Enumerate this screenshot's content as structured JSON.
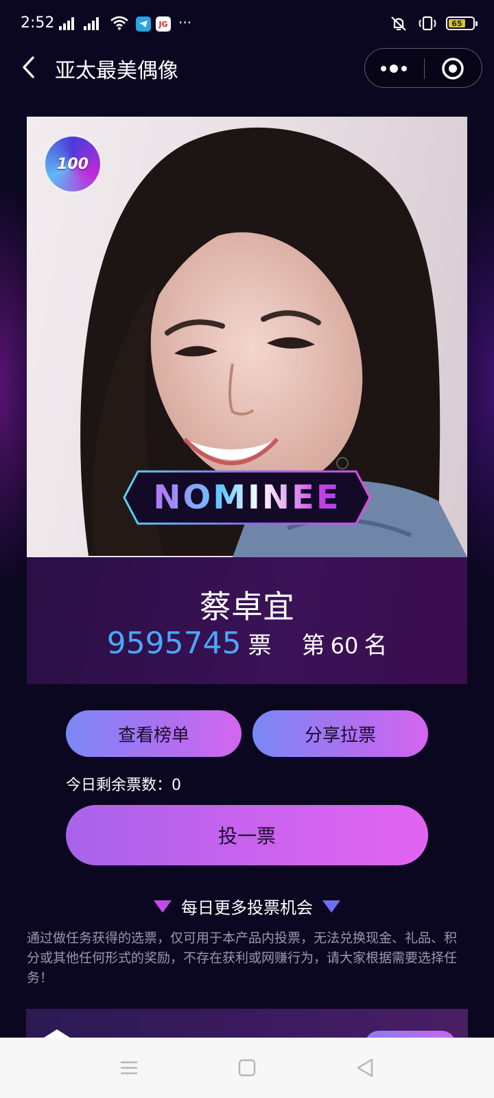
{
  "status_bar": {
    "time": "2:52",
    "app_badge_telegram": "telegram-icon",
    "app_badge_jg": "JG",
    "more": "···",
    "battery": "65",
    "icons": [
      "signal-icon",
      "signal-icon",
      "wifi-icon",
      "vibrate-off-icon",
      "vibrate-icon",
      "battery-icon"
    ]
  },
  "nav": {
    "title": "亚太最美偶像",
    "back_icon": "chevron-left-icon",
    "more_icon": "more-dots-icon",
    "close_icon": "target-circle-icon"
  },
  "card": {
    "badge_text": "100",
    "nominee_label": "NOMINEE",
    "name": "蔡卓宜",
    "votes": "9595745",
    "votes_unit": "票",
    "rank_prefix": "第",
    "rank_value": "60",
    "rank_suffix": "名"
  },
  "actions": {
    "view_rank": "查看榜单",
    "share": "分享拉票",
    "remaining": "今日剩余票数：0",
    "vote": "投一票"
  },
  "more_chances": {
    "label": "每日更多投票机会"
  },
  "disclaimer": "通过做任务获得的选票，仅可用于本产品内投票，无法兑换现金、礼品、积分或其他任何形式的奖励，不存在获利或网赚行为，请大家根据需要选择任务！",
  "system_nav": {
    "menu_icon": "menu-icon",
    "home_icon": "square-icon",
    "back_icon": "triangle-back-icon"
  },
  "colors": {
    "background": "#0b0720",
    "vote_count": "#4aa8ff",
    "button_gradient_start": "#7a88f6",
    "button_gradient_end": "#d466ee"
  }
}
